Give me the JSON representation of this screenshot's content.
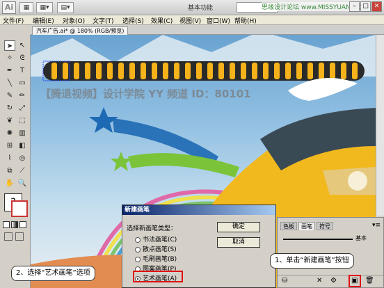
{
  "titlebar": {
    "logo": "Ai",
    "workspace": "基本功能",
    "watermark": "思缘设计论坛 www.MISSYUAN.COM",
    "win_min": "–",
    "win_max": "□",
    "win_close": "✕"
  },
  "menu": [
    "文件(F)",
    "编辑(E)",
    "对象(O)",
    "文字(T)",
    "选择(S)",
    "效果(C)",
    "视图(V)",
    "窗口(W)",
    "帮助(H)"
  ],
  "document_tab": "汽车广告.ai* @ 180% (RGB/预览)",
  "canvas_overlay": "【腾退视频】设计学院 YY 频道 ID：80101",
  "dialog": {
    "title": "新建画笔",
    "label": "选择新画笔类型：",
    "options": [
      "书法画笔(C)",
      "散点画笔(S)",
      "毛刷画笔(B)",
      "图案画笔(P)",
      "艺术画笔(A)"
    ],
    "selected": "艺术画笔(A)",
    "ok": "确定",
    "cancel": "取消"
  },
  "panel": {
    "tabs": [
      "色板",
      "画笔",
      "符号"
    ],
    "active_tab": "画笔",
    "stroke_label": "基本"
  },
  "callouts": {
    "step1": "1、单击“新建画笔”按钮",
    "step2": "2、选择“艺术画笔”选项"
  },
  "colors": {
    "accent_red": "#e01010",
    "ribbon_yellow": "#f5b21a",
    "ribbon_dark": "#2a2a2a",
    "car_yellow": "#f2b91e"
  },
  "icons": {
    "selection": "arrow-icon",
    "new_brush": "new-brush-icon",
    "delete": "trash-icon"
  }
}
